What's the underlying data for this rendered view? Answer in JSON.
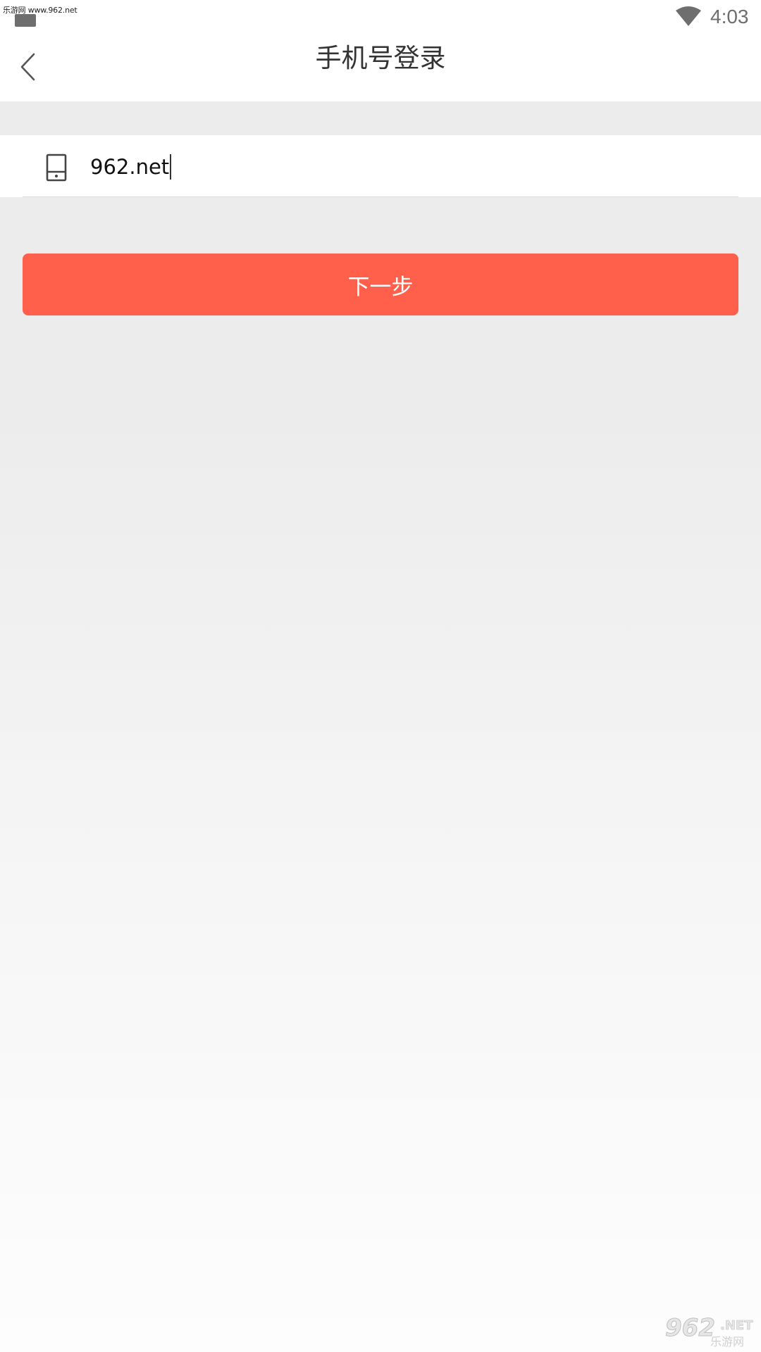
{
  "status_bar": {
    "watermark_text": "乐游网 www.962.net",
    "time": "4:03",
    "icons": [
      "notification-icon",
      "wifi-icon"
    ]
  },
  "header": {
    "title": "手机号登录",
    "back_icon": "chevron-left-icon"
  },
  "phone_field": {
    "icon": "phone-icon",
    "value": "962.net"
  },
  "next_button": {
    "label": "下一步"
  },
  "logo_watermark": {
    "number": "962",
    "suffix": ".NET",
    "cn": "乐游网"
  },
  "colors": {
    "accent": "#ff604b",
    "background": "#ececec",
    "title_text": "#333333"
  }
}
